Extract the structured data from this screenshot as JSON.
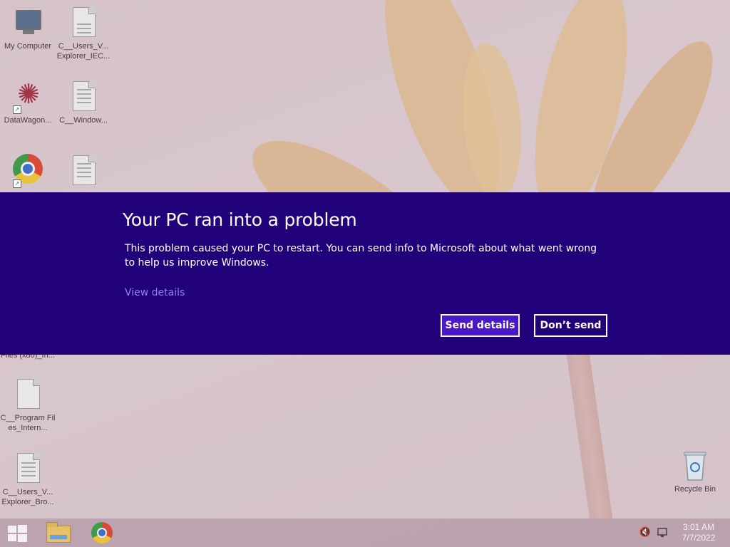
{
  "desktop": {
    "icons": [
      {
        "label": "My Computer",
        "icon": "computer-icon"
      },
      {
        "label": "C__Users_V... Explorer_IEC...",
        "icon": "web-document-icon"
      },
      {
        "label": "DataWagon...",
        "icon": "datawagon-shortcut-icon"
      },
      {
        "label": "C__Window...",
        "icon": "document-icon"
      },
      {
        "label": "Files (x86)_In...",
        "icon": "document-icon"
      },
      {
        "label": "C__Program Files_Intern...",
        "icon": "document-icon"
      },
      {
        "label": "C__Users_V... Explorer_Bro...",
        "icon": "document-icon"
      },
      {
        "label": "Recycle Bin",
        "icon": "recycle-bin-icon"
      }
    ]
  },
  "error_banner": {
    "title": "Your PC ran into a problem",
    "description": "This problem caused your PC to restart. You can send info to Microsoft about what went wrong to help us improve Windows.",
    "view_details_link": "View details",
    "send_button": "Send details",
    "dont_send_button": "Don’t send"
  },
  "taskbar": {
    "items": [
      "start-button",
      "file-explorer",
      "google-chrome"
    ],
    "tray_icons": [
      "volume-muted-icon",
      "network-icon"
    ],
    "clock": {
      "time": "3:01 AM",
      "date": "7/7/2022"
    }
  },
  "colors": {
    "banner_background": "#22027a",
    "send_button_background": "#4a18c8",
    "link_color": "#8f7cf0"
  }
}
